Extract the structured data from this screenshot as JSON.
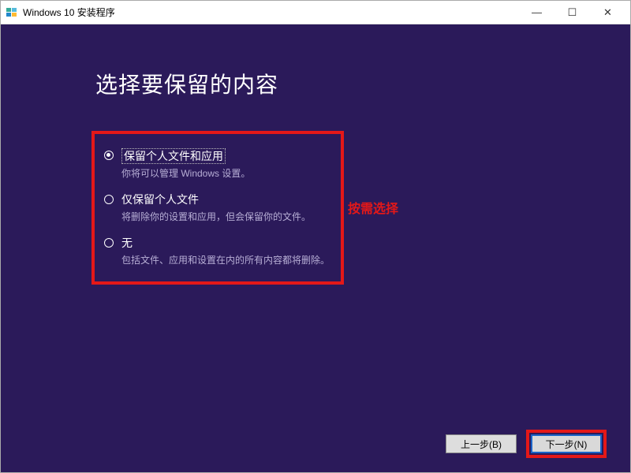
{
  "window": {
    "title": "Windows 10 安装程序"
  },
  "heading": "选择要保留的内容",
  "options": [
    {
      "label": "保留个人文件和应用",
      "desc": "你将可以管理 Windows 设置。",
      "selected": true
    },
    {
      "label": "仅保留个人文件",
      "desc": "将删除你的设置和应用，但会保留你的文件。",
      "selected": false
    },
    {
      "label": "无",
      "desc": "包括文件、应用和设置在内的所有内容都将删除。",
      "selected": false
    }
  ],
  "annotation": "按需选择",
  "buttons": {
    "back": "上一步(B)",
    "next": "下一步(N)"
  },
  "wincontrols": {
    "min": "—",
    "max": "☐",
    "close": "✕"
  }
}
